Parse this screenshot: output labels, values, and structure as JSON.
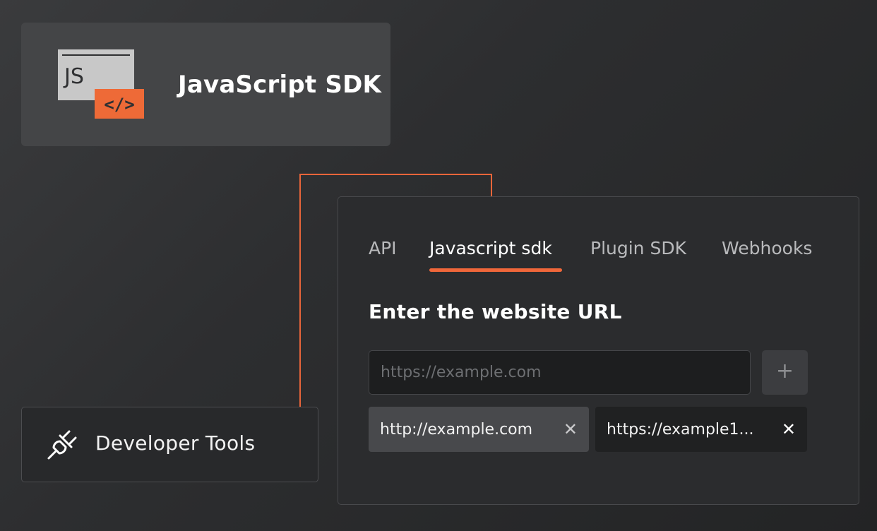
{
  "sdk_card": {
    "title": "JavaScript SDK",
    "logo_text": "JS",
    "logo_code": "</>"
  },
  "developer_tools": {
    "label": "Developer Tools"
  },
  "panel": {
    "tabs": [
      {
        "label": "API"
      },
      {
        "label": "Javascript sdk",
        "active": true
      },
      {
        "label": "Plugin SDK"
      },
      {
        "label": "Webhooks"
      }
    ],
    "heading": "Enter the website URL",
    "url_input": {
      "placeholder": "https://example.com",
      "value": ""
    },
    "add_button_label": "+",
    "chips": [
      {
        "label": "http://example.com",
        "close": "✕"
      },
      {
        "label": "https://example1...",
        "close": "✕"
      }
    ]
  },
  "colors": {
    "accent": "#f0673a",
    "background": "#2d2e30",
    "card": "#444547"
  },
  "icons": [
    "js-code-icon",
    "plug-disconnect-icon",
    "plus-icon",
    "close-icon"
  ]
}
